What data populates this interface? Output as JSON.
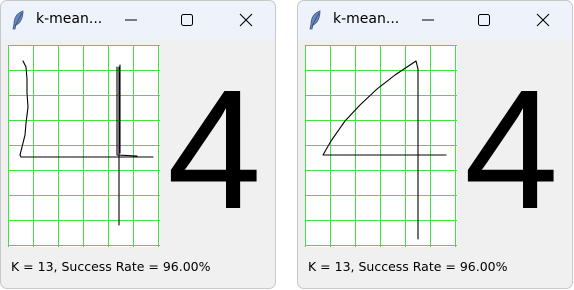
{
  "windows": [
    {
      "title": "k-mean...",
      "prediction": "4",
      "status": "K = 13, Success Rate = 96.00%"
    },
    {
      "title": "k-mean...",
      "prediction": "4",
      "status": "K = 13, Success Rate = 96.00%"
    }
  ],
  "colors": {
    "grid": "#3fe33f",
    "stroke": "#000000",
    "titlebar": "#eef2fa",
    "window_bg": "#f0f0f0"
  },
  "icons": {
    "app": "feather-icon",
    "minimize": "minimize-icon",
    "maximize": "maximize-icon",
    "close": "close-icon"
  }
}
